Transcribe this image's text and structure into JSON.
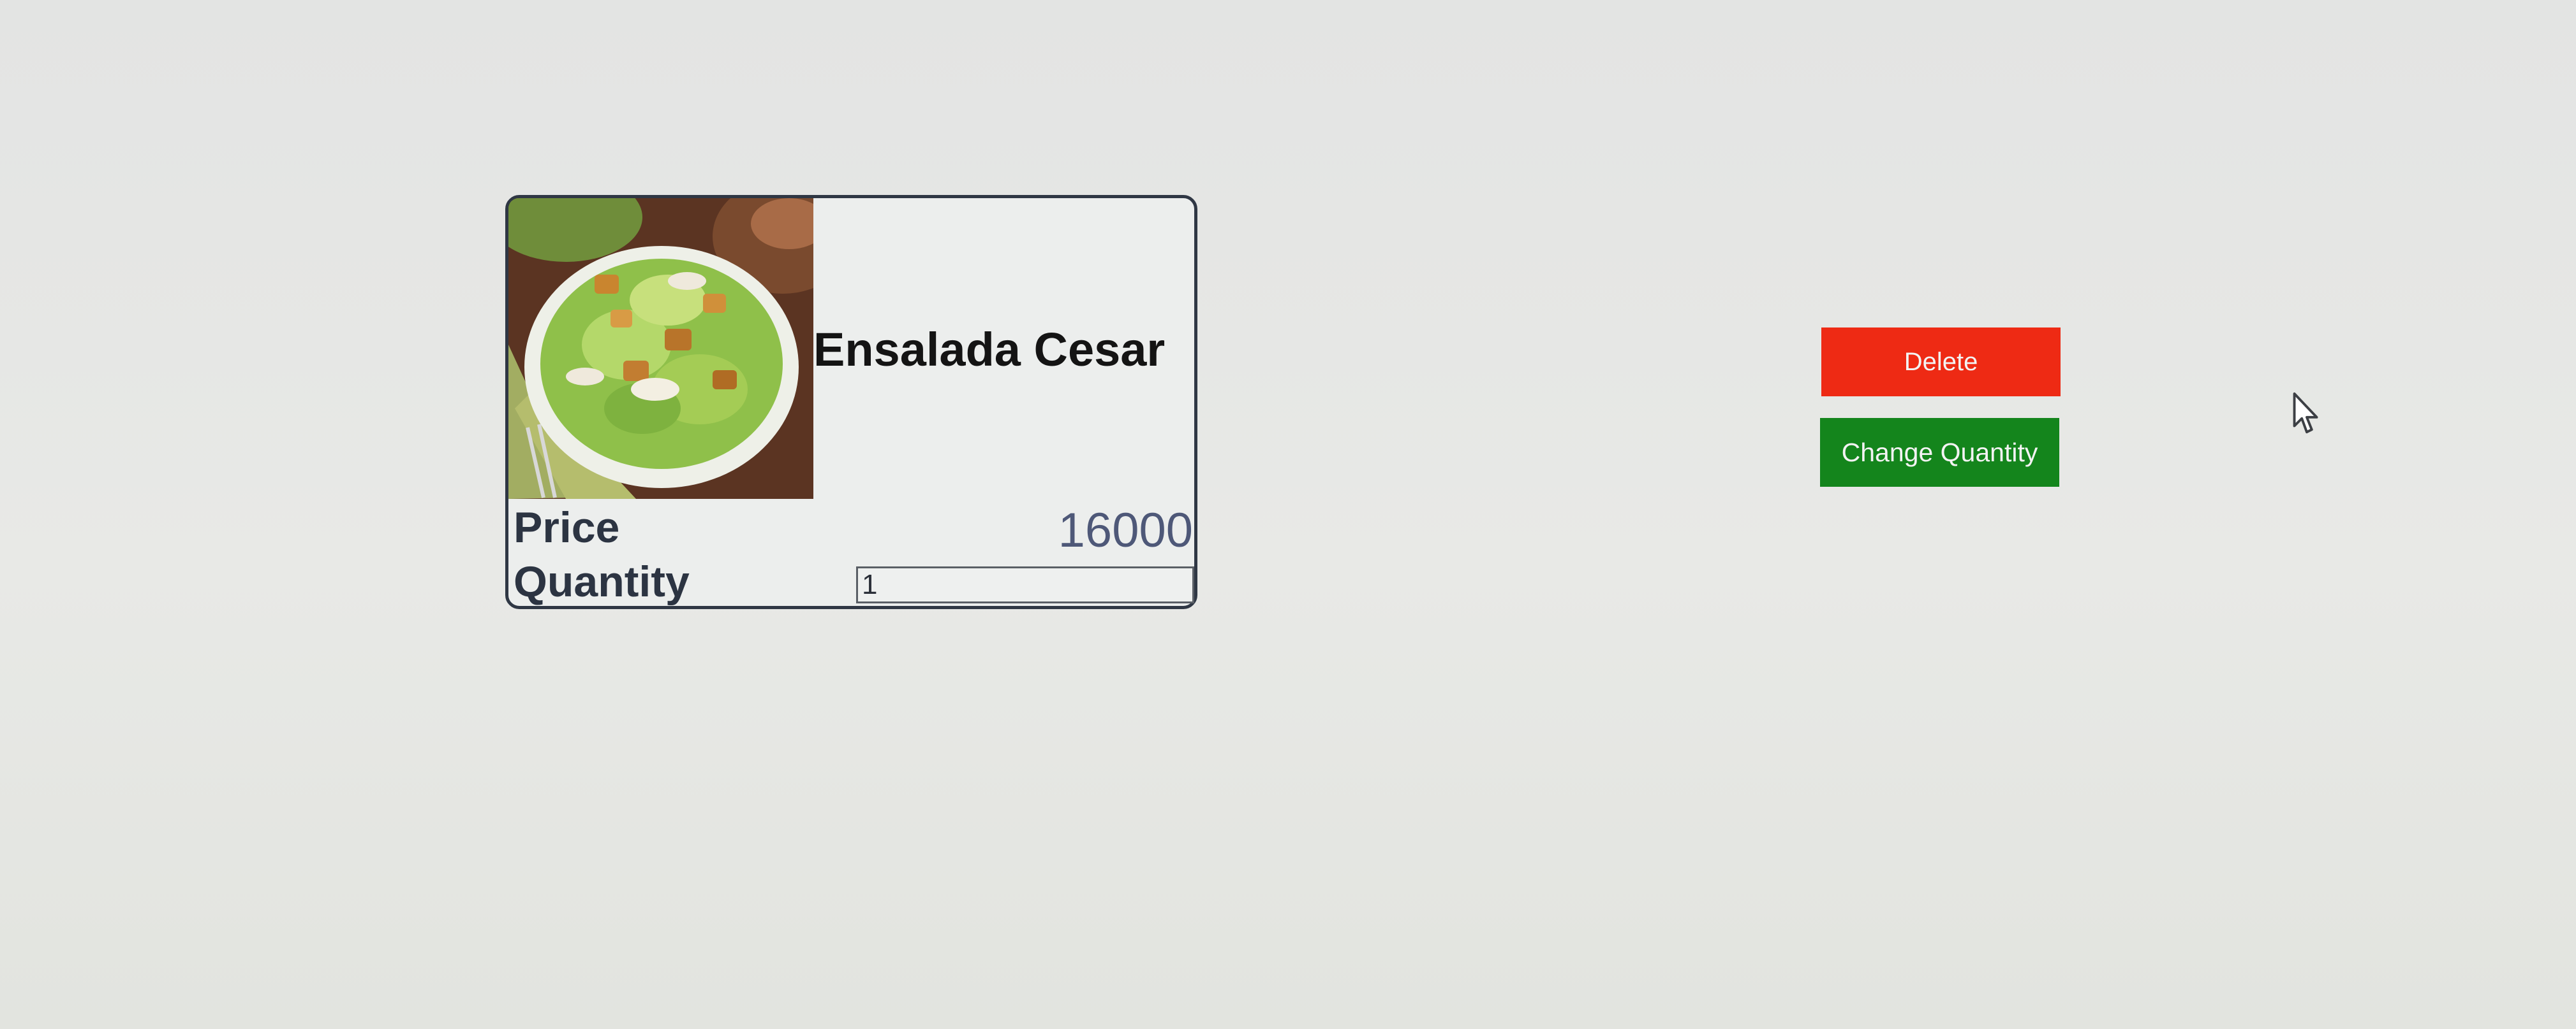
{
  "card": {
    "image_alt": "salad-photo",
    "title": "Ensalada Cesar",
    "price_label": "Price",
    "price_value": "16000",
    "quantity_label": "Quantity",
    "quantity_value": "1"
  },
  "actions": {
    "delete_label": "Delete",
    "change_quantity_label": "Change Quantity"
  },
  "colors": {
    "delete": "#ee2a14",
    "change_quantity": "#14851c",
    "card_border": "#2f3744"
  },
  "icons": {
    "cursor": "mouse-pointer-icon"
  }
}
